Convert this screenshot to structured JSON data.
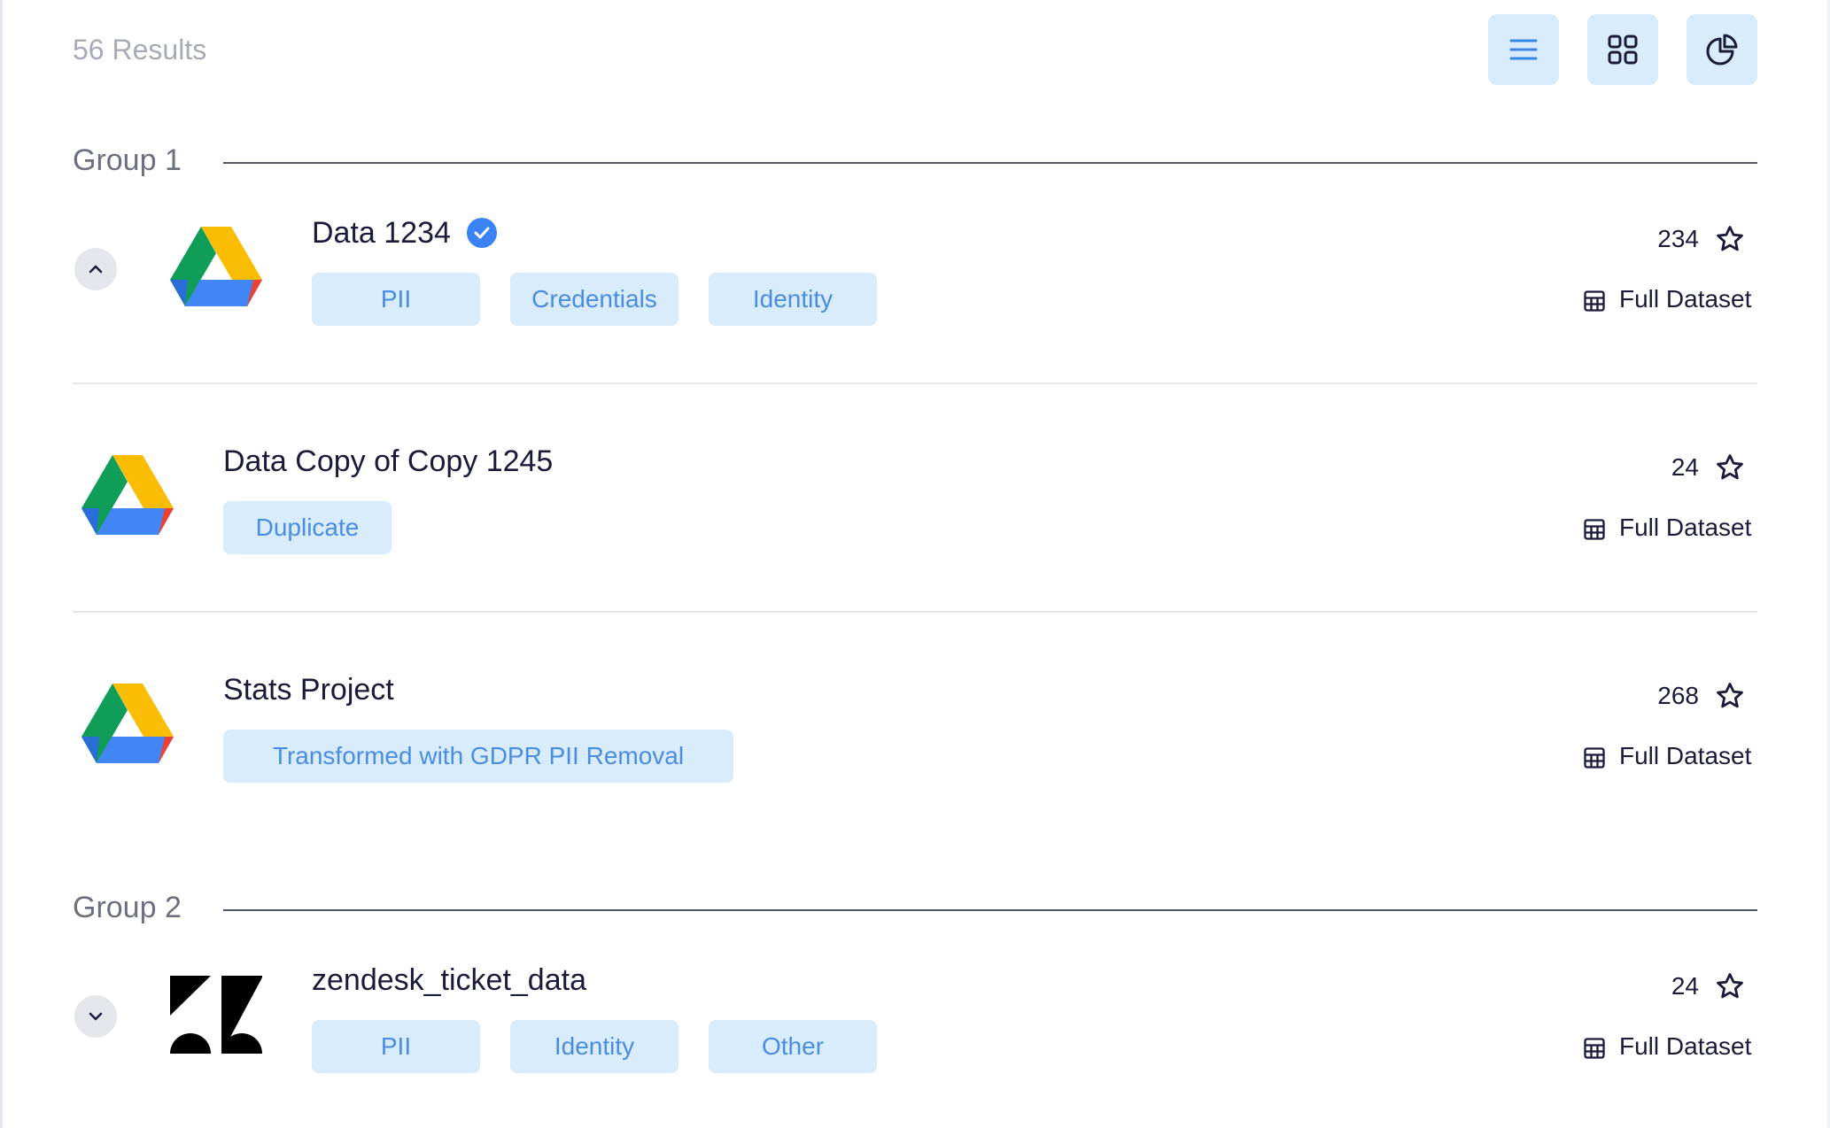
{
  "header": {
    "results_label": "56 Results",
    "view_buttons": [
      {
        "name": "list-view",
        "icon": "list-icon"
      },
      {
        "name": "grid-view",
        "icon": "grid-icon"
      },
      {
        "name": "chart-view",
        "icon": "pie-chart-icon"
      }
    ]
  },
  "groups": [
    {
      "label": "Group 1",
      "items": [
        {
          "title": "Data 1234",
          "verified": true,
          "icon": "google-drive-logo",
          "tags": [
            "PII",
            "Credentials",
            "Identity"
          ],
          "count": "234",
          "dataset": "Full Dataset",
          "toggle": "chevron-up-icon"
        },
        {
          "title": "Data Copy of Copy 1245",
          "verified": false,
          "icon": "google-drive-logo",
          "tags": [
            "Duplicate"
          ],
          "count": "24",
          "dataset": "Full Dataset"
        },
        {
          "title": "Stats Project",
          "verified": false,
          "icon": "google-drive-logo",
          "tags": [
            "Transformed with GDPR PII Removal"
          ],
          "count": "268",
          "dataset": "Full Dataset"
        }
      ]
    },
    {
      "label": "Group 2",
      "items": [
        {
          "title": "zendesk_ticket_data",
          "verified": false,
          "icon": "zendesk-logo",
          "tags": [
            "PII",
            "Identity",
            "Other"
          ],
          "count": "24",
          "dataset": "Full Dataset",
          "toggle": "chevron-down-icon"
        }
      ]
    }
  ],
  "colors": {
    "accent": "#4a8de3",
    "tag_bg": "#d8ecfb",
    "text_primary": "#1a1b3a",
    "text_muted": "#a7aab7",
    "verified": "#3b82f6"
  }
}
